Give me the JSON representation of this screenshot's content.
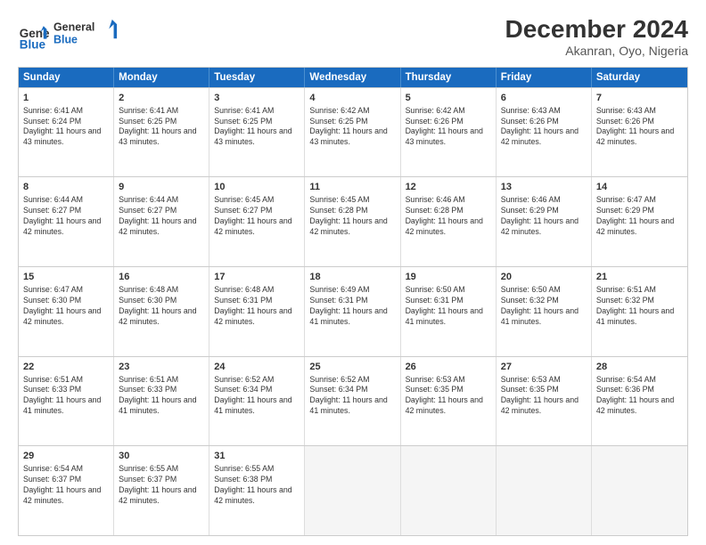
{
  "logo": {
    "line1": "General",
    "line2": "Blue"
  },
  "title": "December 2024",
  "location": "Akanran, Oyo, Nigeria",
  "header_days": [
    "Sunday",
    "Monday",
    "Tuesday",
    "Wednesday",
    "Thursday",
    "Friday",
    "Saturday"
  ],
  "weeks": [
    [
      {
        "day": "1",
        "sunrise": "6:41 AM",
        "sunset": "6:24 PM",
        "daylight": "11 hours and 43 minutes."
      },
      {
        "day": "2",
        "sunrise": "6:41 AM",
        "sunset": "6:25 PM",
        "daylight": "11 hours and 43 minutes."
      },
      {
        "day": "3",
        "sunrise": "6:41 AM",
        "sunset": "6:25 PM",
        "daylight": "11 hours and 43 minutes."
      },
      {
        "day": "4",
        "sunrise": "6:42 AM",
        "sunset": "6:25 PM",
        "daylight": "11 hours and 43 minutes."
      },
      {
        "day": "5",
        "sunrise": "6:42 AM",
        "sunset": "6:26 PM",
        "daylight": "11 hours and 43 minutes."
      },
      {
        "day": "6",
        "sunrise": "6:43 AM",
        "sunset": "6:26 PM",
        "daylight": "11 hours and 42 minutes."
      },
      {
        "day": "7",
        "sunrise": "6:43 AM",
        "sunset": "6:26 PM",
        "daylight": "11 hours and 42 minutes."
      }
    ],
    [
      {
        "day": "8",
        "sunrise": "6:44 AM",
        "sunset": "6:27 PM",
        "daylight": "11 hours and 42 minutes."
      },
      {
        "day": "9",
        "sunrise": "6:44 AM",
        "sunset": "6:27 PM",
        "daylight": "11 hours and 42 minutes."
      },
      {
        "day": "10",
        "sunrise": "6:45 AM",
        "sunset": "6:27 PM",
        "daylight": "11 hours and 42 minutes."
      },
      {
        "day": "11",
        "sunrise": "6:45 AM",
        "sunset": "6:28 PM",
        "daylight": "11 hours and 42 minutes."
      },
      {
        "day": "12",
        "sunrise": "6:46 AM",
        "sunset": "6:28 PM",
        "daylight": "11 hours and 42 minutes."
      },
      {
        "day": "13",
        "sunrise": "6:46 AM",
        "sunset": "6:29 PM",
        "daylight": "11 hours and 42 minutes."
      },
      {
        "day": "14",
        "sunrise": "6:47 AM",
        "sunset": "6:29 PM",
        "daylight": "11 hours and 42 minutes."
      }
    ],
    [
      {
        "day": "15",
        "sunrise": "6:47 AM",
        "sunset": "6:30 PM",
        "daylight": "11 hours and 42 minutes."
      },
      {
        "day": "16",
        "sunrise": "6:48 AM",
        "sunset": "6:30 PM",
        "daylight": "11 hours and 42 minutes."
      },
      {
        "day": "17",
        "sunrise": "6:48 AM",
        "sunset": "6:31 PM",
        "daylight": "11 hours and 42 minutes."
      },
      {
        "day": "18",
        "sunrise": "6:49 AM",
        "sunset": "6:31 PM",
        "daylight": "11 hours and 41 minutes."
      },
      {
        "day": "19",
        "sunrise": "6:50 AM",
        "sunset": "6:31 PM",
        "daylight": "11 hours and 41 minutes."
      },
      {
        "day": "20",
        "sunrise": "6:50 AM",
        "sunset": "6:32 PM",
        "daylight": "11 hours and 41 minutes."
      },
      {
        "day": "21",
        "sunrise": "6:51 AM",
        "sunset": "6:32 PM",
        "daylight": "11 hours and 41 minutes."
      }
    ],
    [
      {
        "day": "22",
        "sunrise": "6:51 AM",
        "sunset": "6:33 PM",
        "daylight": "11 hours and 41 minutes."
      },
      {
        "day": "23",
        "sunrise": "6:51 AM",
        "sunset": "6:33 PM",
        "daylight": "11 hours and 41 minutes."
      },
      {
        "day": "24",
        "sunrise": "6:52 AM",
        "sunset": "6:34 PM",
        "daylight": "11 hours and 41 minutes."
      },
      {
        "day": "25",
        "sunrise": "6:52 AM",
        "sunset": "6:34 PM",
        "daylight": "11 hours and 41 minutes."
      },
      {
        "day": "26",
        "sunrise": "6:53 AM",
        "sunset": "6:35 PM",
        "daylight": "11 hours and 42 minutes."
      },
      {
        "day": "27",
        "sunrise": "6:53 AM",
        "sunset": "6:35 PM",
        "daylight": "11 hours and 42 minutes."
      },
      {
        "day": "28",
        "sunrise": "6:54 AM",
        "sunset": "6:36 PM",
        "daylight": "11 hours and 42 minutes."
      }
    ],
    [
      {
        "day": "29",
        "sunrise": "6:54 AM",
        "sunset": "6:37 PM",
        "daylight": "11 hours and 42 minutes."
      },
      {
        "day": "30",
        "sunrise": "6:55 AM",
        "sunset": "6:37 PM",
        "daylight": "11 hours and 42 minutes."
      },
      {
        "day": "31",
        "sunrise": "6:55 AM",
        "sunset": "6:38 PM",
        "daylight": "11 hours and 42 minutes."
      },
      null,
      null,
      null,
      null
    ]
  ],
  "labels": {
    "sunrise": "Sunrise:",
    "sunset": "Sunset:",
    "daylight": "Daylight:"
  }
}
